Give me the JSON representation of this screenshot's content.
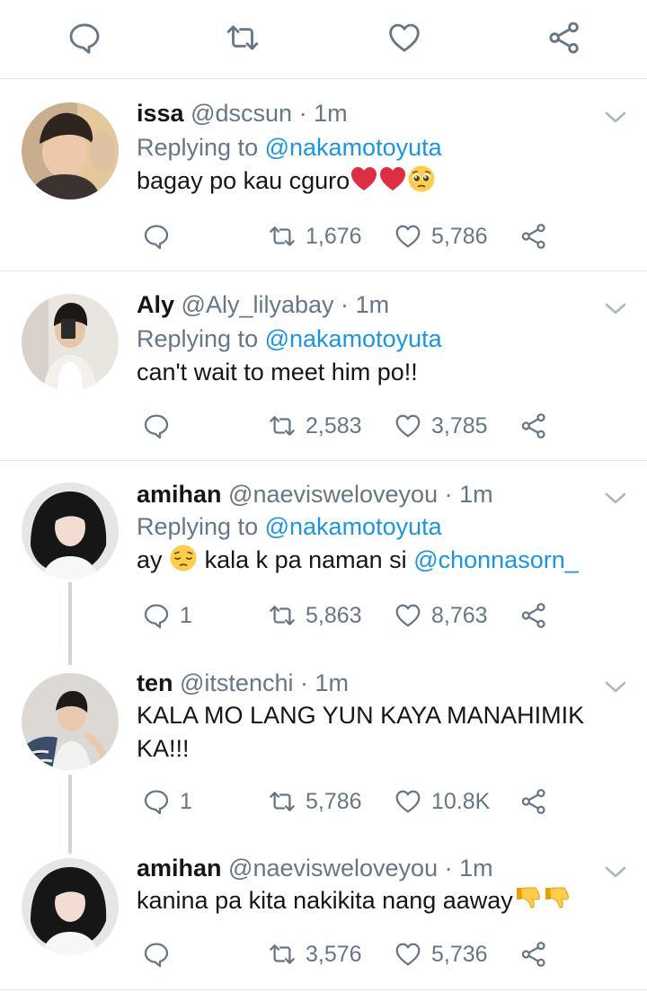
{
  "colors": {
    "link": "#1b95e0",
    "muted": "#657786",
    "text": "#14171a",
    "divider": "#e1e8ed",
    "thread": "#ccd6dd"
  },
  "top_actions": [
    "reply-icon",
    "retweet-icon",
    "like-icon",
    "share-icon"
  ],
  "tweets": [
    {
      "name": "issa",
      "handle": "@dscsun",
      "dot": "·",
      "time": "1m",
      "replying_prefix": "Replying to",
      "replying_to": "@nakamotoyuta",
      "text": "bagay po kau cguro",
      "emojis": [
        "red-heart",
        "red-heart",
        "pleading-face"
      ],
      "replies": "",
      "retweets": "1,676",
      "likes": "5,786"
    },
    {
      "name": "Aly",
      "handle": "@Aly_lilyabay",
      "dot": "·",
      "time": "1m",
      "replying_prefix": "Replying to",
      "replying_to": "@nakamotoyuta",
      "text": "can't wait to meet him po!!",
      "replies": "",
      "retweets": "2,583",
      "likes": "3,785"
    },
    {
      "name": "amihan",
      "handle": "@naevisweloveyou",
      "dot": "·",
      "time": "1m",
      "replying_prefix": "Replying to",
      "replying_to": "@nakamotoyuta",
      "text_before": "ay",
      "text_middle": "kala k pa naman si",
      "mention": "@chonnasorn_",
      "emojis": [
        "pensive-face"
      ],
      "replies": "1",
      "retweets": "5,863",
      "likes": "8,763"
    },
    {
      "name": "ten",
      "handle": "@itstenchi",
      "dot": "·",
      "time": "1m",
      "text": "KALA MO LANG YUN KAYA MANAHIMIK KA!!!",
      "replies": "1",
      "retweets": "5,786",
      "likes": "10.8K"
    },
    {
      "name": "amihan",
      "handle": "@naevisweloveyou",
      "dot": "·",
      "time": "1m",
      "text": "kanina pa kita nakikita nang aaway",
      "emojis": [
        "thumbs-down",
        "thumbs-down"
      ],
      "replies": "",
      "retweets": "3,576",
      "likes": "5,736"
    }
  ]
}
